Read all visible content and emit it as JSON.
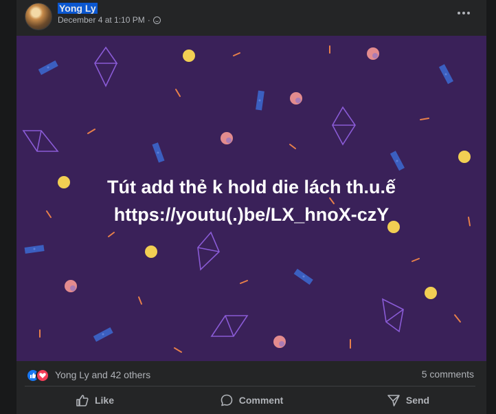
{
  "post": {
    "author": "Yong Ly",
    "timestamp": "December 4 at 1:10 PM",
    "separator": "·",
    "text_line1": "Tút add thẻ k hold die lách th.u.ế",
    "text_line2": "https://youtu(.)be/LX_hnoX-czY",
    "background_color": "#3a2159"
  },
  "stats": {
    "reactions_text": "Yong Ly and 42 others",
    "comments_text": "5 comments"
  },
  "actions": {
    "like": "Like",
    "comment": "Comment",
    "send": "Send"
  },
  "icons": [
    "more-options-icon",
    "globe-icon",
    "like-reaction-icon",
    "love-reaction-icon",
    "like-icon",
    "comment-icon",
    "send-icon"
  ]
}
